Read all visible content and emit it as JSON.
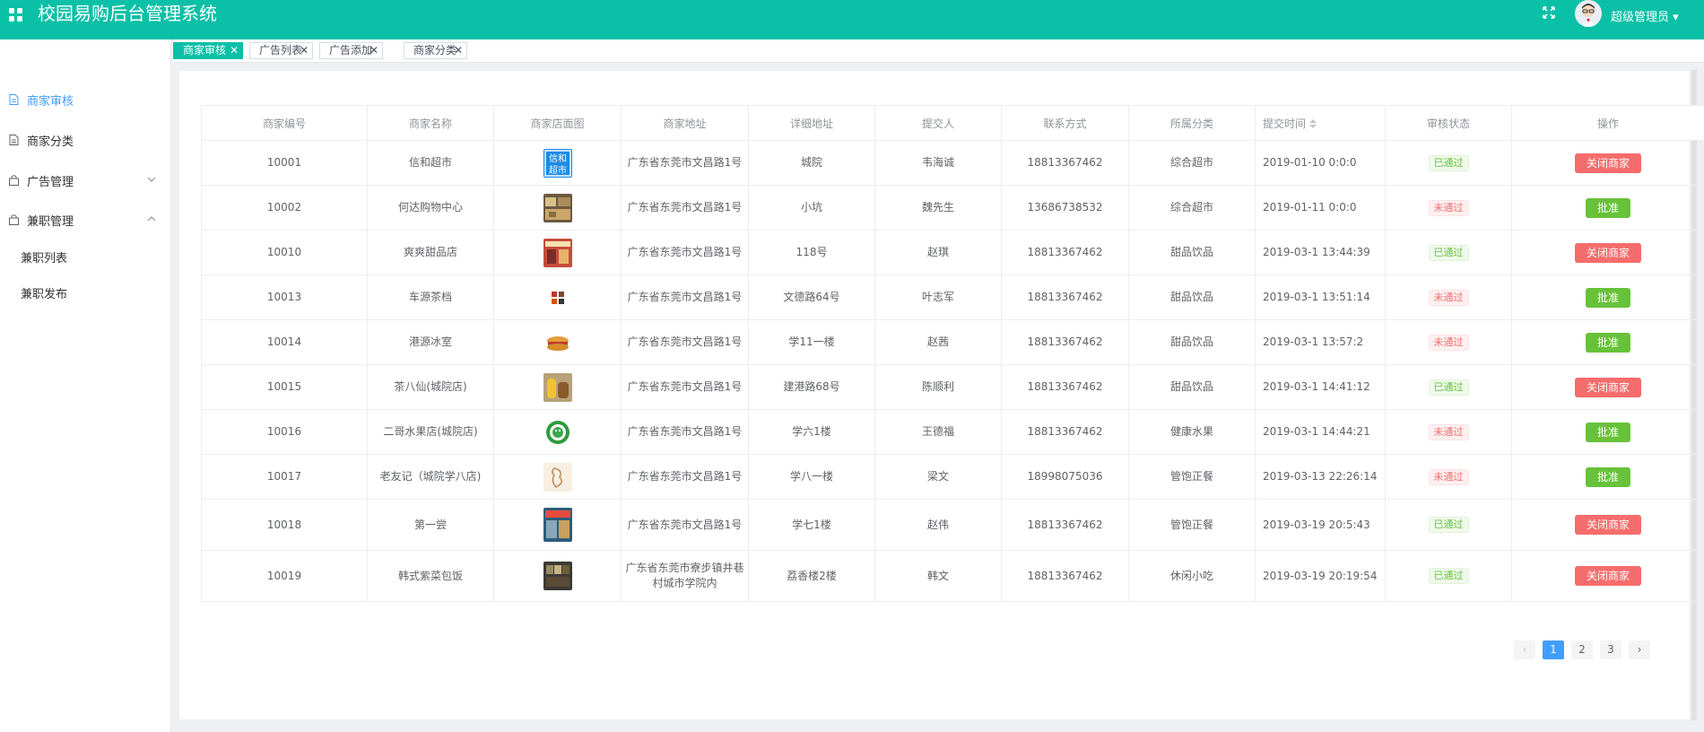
{
  "header": {
    "app_title": "校园易购后台管理系统",
    "user_label": "超级管理员 ▾",
    "icons": [
      "grid-icon",
      "fullscreen-icon",
      "avatar"
    ]
  },
  "sidebar": {
    "items": [
      {
        "label": "商家审核",
        "active": true
      },
      {
        "label": "商家分类"
      },
      {
        "label": "广告管理",
        "arrow": "down"
      },
      {
        "label": "兼职管理",
        "arrow": "up"
      }
    ],
    "sub_items": [
      {
        "label": "兼职列表"
      },
      {
        "label": "兼职发布"
      }
    ]
  },
  "tabs": [
    {
      "label": "商家审核",
      "active": true
    },
    {
      "label": "广告列表"
    },
    {
      "label": "广告添加"
    },
    {
      "label": "商家分类"
    }
  ],
  "table": {
    "columns": [
      "商家编号",
      "商家名称",
      "商家店面图",
      "商家地址",
      "详细地址",
      "提交人",
      "联系方式",
      "所属分类",
      "提交时间",
      "审核状态",
      "操作"
    ],
    "rows": [
      {
        "id": "10001",
        "name": "信和超市",
        "address": "广东省东莞市文昌路1号",
        "detail": "城院",
        "submitter": "韦海诚",
        "phone": "18813367462",
        "category": "综合超市",
        "time": "2019-01-10 0:0:0",
        "status": "已通过",
        "action": "关闭商家"
      },
      {
        "id": "10002",
        "name": "何达购物中心",
        "address": "广东省东莞市文昌路1号",
        "detail": "小坑",
        "submitter": "魏先生",
        "phone": "13686738532",
        "category": "综合超市",
        "time": "2019-01-11 0:0:0",
        "status": "未通过",
        "action": "批准"
      },
      {
        "id": "10010",
        "name": "爽爽甜品店",
        "address": "广东省东莞市文昌路1号",
        "detail": "118号",
        "submitter": "赵琪",
        "phone": "18813367462",
        "category": "甜品饮品",
        "time": "2019-03-1 13:44:39",
        "status": "已通过",
        "action": "关闭商家"
      },
      {
        "id": "10013",
        "name": "车源茶档",
        "address": "广东省东莞市文昌路1号",
        "detail": "文德路64号",
        "submitter": "叶志军",
        "phone": "18813367462",
        "category": "甜品饮品",
        "time": "2019-03-1 13:51:14",
        "status": "未通过",
        "action": "批准"
      },
      {
        "id": "10014",
        "name": "港源冰室",
        "address": "广东省东莞市文昌路1号",
        "detail": "学11一楼",
        "submitter": "赵茜",
        "phone": "18813367462",
        "category": "甜品饮品",
        "time": "2019-03-1 13:57:2",
        "status": "未通过",
        "action": "批准"
      },
      {
        "id": "10015",
        "name": "茶八仙(城院店)",
        "address": "广东省东莞市文昌路1号",
        "detail": "建港路68号",
        "submitter": "陈顺利",
        "phone": "18813367462",
        "category": "甜品饮品",
        "time": "2019-03-1 14:41:12",
        "status": "已通过",
        "action": "关闭商家"
      },
      {
        "id": "10016",
        "name": "二哥水果店(城院店)",
        "address": "广东省东莞市文昌路1号",
        "detail": "学六1楼",
        "submitter": "王德福",
        "phone": "18813367462",
        "category": "健康水果",
        "time": "2019-03-1 14:44:21",
        "status": "未通过",
        "action": "批准"
      },
      {
        "id": "10017",
        "name": "老友记（城院学八店)",
        "address": "广东省东莞市文昌路1号",
        "detail": "学八一楼",
        "submitter": "梁文",
        "phone": "18998075036",
        "category": "管饱正餐",
        "time": "2019-03-13 22:26:14",
        "status": "未通过",
        "action": "批准"
      },
      {
        "id": "10018",
        "name": "第一尝",
        "address": "广东省东莞市文昌路1号",
        "detail": "学七1楼",
        "submitter": "赵伟",
        "phone": "18813367462",
        "category": "管饱正餐",
        "time": "2019-03-19 20:5:43",
        "status": "已通过",
        "action": "关闭商家"
      },
      {
        "id": "10019",
        "name": "韩式紫菜包饭",
        "address": "广东省东莞市寮步镇井巷村城市学院内",
        "detail": "荔香楼2楼",
        "submitter": "韩文",
        "phone": "18813367462",
        "category": "休闲小吃",
        "time": "2019-03-19 20:19:54",
        "status": "已通过",
        "action": "关闭商家"
      }
    ],
    "thumb_1_text": "信和超市"
  },
  "pagination": {
    "prev": "‹",
    "pages": [
      "1",
      "2",
      "3"
    ],
    "current": "1",
    "next": "›"
  },
  "colors": {
    "header_bg": "#0ac0a7",
    "primary": "#409eff",
    "danger": "#f56c6c",
    "success": "#67c23a"
  }
}
